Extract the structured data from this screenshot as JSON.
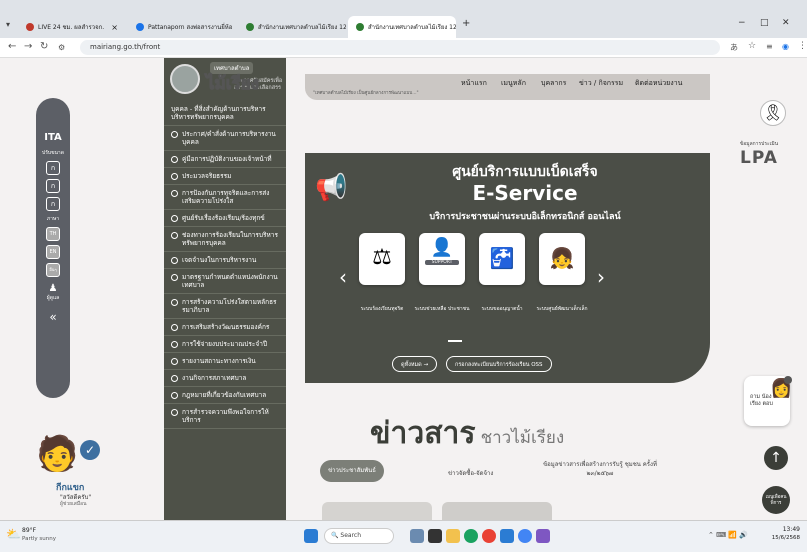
{
  "browser": {
    "tabs": [
      {
        "label": "LIVE 24 ชม. ผลสำรวจก.",
        "color": "#c0392b"
      },
      {
        "label": "Pattanaporn สงพ่อสารงานยี่ห้อ",
        "color": "#1a73e8"
      },
      {
        "label": "สำนักงานเทศบาลตำบลไม้เรียง 12 ก.",
        "color": "#2e7d32"
      },
      {
        "label": "สำนักงานเทศบาลตำบลไม้เรียง 12 ก.",
        "color": "#2e7d32"
      }
    ],
    "new_tab": "+",
    "url": "mairiang.go.th/front",
    "window_controls": [
      "−",
      "□",
      "✕"
    ]
  },
  "logo": {
    "small": "เทศบาลตำบล",
    "large": "ไม้เรียง"
  },
  "ita": {
    "title": "ITA",
    "sub": "ปรับขนาด",
    "buttons": [
      "ก",
      "ก",
      "ก"
    ],
    "theme_label": "ภาษา",
    "lang": [
      "TH",
      "EN"
    ],
    "other": "อื่นๆ",
    "user_label": "ผู้ดูแล",
    "collapse": "«"
  },
  "menu": {
    "partial_top": "ประกาศรับสมัครเพื่อสรรหาและเลือกสรร",
    "items": [
      "บุคคล - ที่สิ่งสำคัญด้านการบริหาร บริหารทรัพยากรบุคคล",
      "ประกาศ/คำสั่งด้านการบริหารงาน บุคคล",
      "คู่มือการปฏิบัติงานของเจ้าหน้าที่",
      "ประมวลจริยธรรม",
      "การป้องกันการทุจริตและการส่ง เสริมความโปร่งใส",
      "ศูนย์รับเรื่องร้องเรียน/ร้องทุกข์",
      "ช่องทางการร้องเรียนในการบริหาร ทรัพยากรบุคคล",
      "เจตจำนงในการบริหารงาน",
      "มาตรฐานกำหนดตำแหน่งพนักงาน เทศบาล",
      "การสร้างความโปร่งใสตามหลักธร รมาภิบาล",
      "การเสริมสร้างวัฒนธรรมองค์กร",
      "การใช้จ่ายงบประมาณประจำปี",
      "รายงานสถานะทางการเงิน",
      "งานกิจการสภาเทศบาล",
      "กฎหมายที่เกี่ยวข้องกับเทศบาล",
      "การสำรวจความพึงพอใจการให้ บริการ"
    ]
  },
  "nav": {
    "links": [
      "หน้าแรก",
      "เมนูหลัก",
      "บุคลากร",
      "ข่าว / กิจกรรม",
      "ติดต่อหน่วยงาน"
    ],
    "marquee": "\"เทศบาลตำบลไม้เรียง เป็นศูนย์กลางการพัฒนาแบบ...\""
  },
  "hero": {
    "title_th": "ศูนย์บริการแบบเบ็ดเสร็จ",
    "title_en": "E-Service",
    "subtitle": "บริการประชาชนผ่านระบบอิเล็กทรอนิกส์ ออนไลน์",
    "cards": [
      {
        "label": "ระบบร้องเรียนทุจริต"
      },
      {
        "label": "ระบบช่วยเหลือ ประชาชน",
        "badge": "SUPPORT"
      },
      {
        "label": "ระบบขออนุญาตน้ำ"
      },
      {
        "label": "ระบบศูนย์พัฒนาเด็กเล็ก"
      }
    ],
    "prev": "‹",
    "next": "›",
    "btn_all": "ดูทั้งหมด →",
    "btn_oss": "กรอกลงทะเบียนบริการร้องเรียน OSS"
  },
  "news": {
    "title_main": "ข่าวสาร",
    "title_sub": "ชาวไม้เรียง",
    "tabs": [
      "ข่าวประชาสัมพันธ์",
      "ข่าวจัดซื้อ-จัดจ้าง",
      "ข้อมูลข่าวสารเพื่อสร้างการรับรู้ ชุมชน ครั้งที่ ๒๓/๒๕๖๗"
    ]
  },
  "right": {
    "lpa_top": "ข้อมูลการประเมิน",
    "lpa": "LPA",
    "mourning": "ribbon",
    "chat_label": "ถาม น้องเรียง ตอบ",
    "up": "↑",
    "accessibility": "เมนูเพื่อคนพิการ"
  },
  "mascot": {
    "name": "กีกแขก",
    "sub": "\"สวัสดีครับ\"",
    "sub2": "ผู้ช่วยเสมือน"
  },
  "taskbar": {
    "weather": "89°F",
    "weather_sub": "Partly sunny",
    "search": "Search",
    "time": "13:49",
    "date": "15/6/2568"
  }
}
